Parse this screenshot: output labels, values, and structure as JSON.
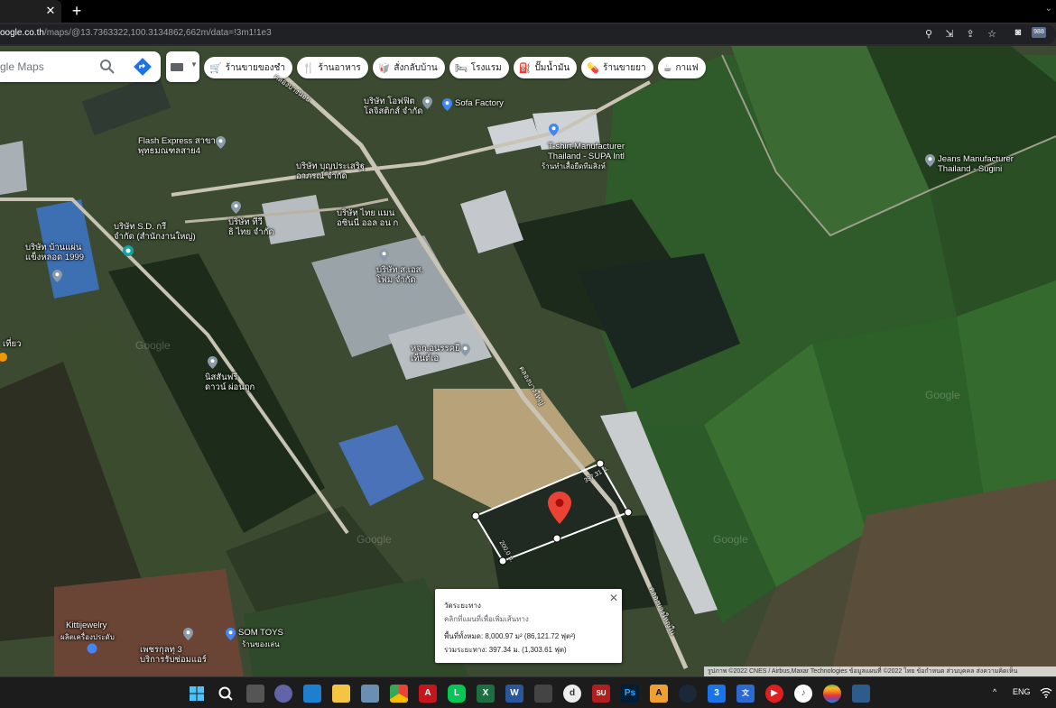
{
  "browser": {
    "close_tab": "✕",
    "new_tab": "+",
    "url_host": "oogle.co.th",
    "url_rest": "/maps/@13.7363322,100.3134862,662m/data=!3m1!1e3",
    "ext_badge": "988"
  },
  "search": {
    "placeholder": "gle Maps"
  },
  "chips": [
    {
      "icon": "🛒",
      "label": "ร้านขายของชำ"
    },
    {
      "icon": "🍴",
      "label": "ร้านอาหาร"
    },
    {
      "icon": "🥡",
      "label": "สั่งกลับบ้าน"
    },
    {
      "icon": "🛏",
      "label": "โรงแรม"
    },
    {
      "icon": "⛽",
      "label": "ปั๊มน้ำมัน"
    },
    {
      "icon": "💊",
      "label": "ร้านขายยา"
    },
    {
      "icon": "☕",
      "label": "กาแฟ"
    }
  ],
  "places": {
    "sofa_factory": "Sofa Factory",
    "office": "บริษัท โอฟฟิต\nโลจิสติกส์ จำกัด",
    "flash": "Flash Express สาขา\nพุทธมณฑลสาย4",
    "tshirt": "T-shirt Manufacturer\nThailand - SUPA Intl",
    "tshirt_sub": "ร้านทำเสื้อยืดทีมสิงห์",
    "jeans": "Jeans Manufacturer\nThailand - Sugini",
    "boonprasert": "บริษัท บุญประเสริฐ\nอาภรณ์ จำกัด",
    "tv": "บริษัท ทีวี\nธิ ไทย จำกัด",
    "company2": "บริษัท ไทย แมน\nอซินนี่ ออล อน ก",
    "sd": "บริษัท S.D. กรี\nจำกัด (สำนักงานใหญ่)",
    "banmaen": "บริษัท บ้านแผ่น\nแข็งหลอด 1999",
    "sl": "บริษัท ส.เอส.\nโฟม จำกัด",
    "hok": "หจก.อนรรคยี\nเท็นต์เอ",
    "nissan": "นิสสันฟรี\nดาวน์ ผ่อนถูก",
    "kitti": "Kittijewelry",
    "kitti_sub": "ผลิตเครื่องประดับ",
    "somtoys": "SOM TOYS",
    "somtoys_sub": "ร้านของเล่น",
    "village": "เพชรกุลทุ 3\nบริการรับซ่อมแอร์",
    "left_edge": "เที่ยว"
  },
  "roads": {
    "r1": "คลองบางน้อย",
    "r2": "คลองบางใหญ่",
    "r3": "คลองบางใหญ่ใน"
  },
  "measure": {
    "seg1": "397.31 ม.",
    "seg2": "200.0 ม."
  },
  "infocard": {
    "title": "วัดระยะทาง",
    "subtitle": "คลิกที่แผนที่เพื่อเพิ่มเส้นทาง",
    "area": "พื้นที่ทั้งหมด: 8,000.97 ม² (86,121.72 ฟุต²)",
    "distance": "รวมระยะทาง: 397.34 ม. (1,303.61 ฟุต)",
    "close": "✕"
  },
  "footer": "รูปภาพ ©2022 CNES / Airbus,Maxar Technologies ข้อมูลแผนที่ ©2022   ไทย   ข้อกำหนด   ส่วนบุคคล   ส่งความคิดเห็น",
  "watermarks": [
    "Google",
    "Google",
    "Google",
    "Google"
  ],
  "taskbar": {
    "lang": "ENG",
    "up_arrow": "^"
  },
  "colors": {
    "accent": "#1a73e8",
    "pin": "#ea4335"
  }
}
